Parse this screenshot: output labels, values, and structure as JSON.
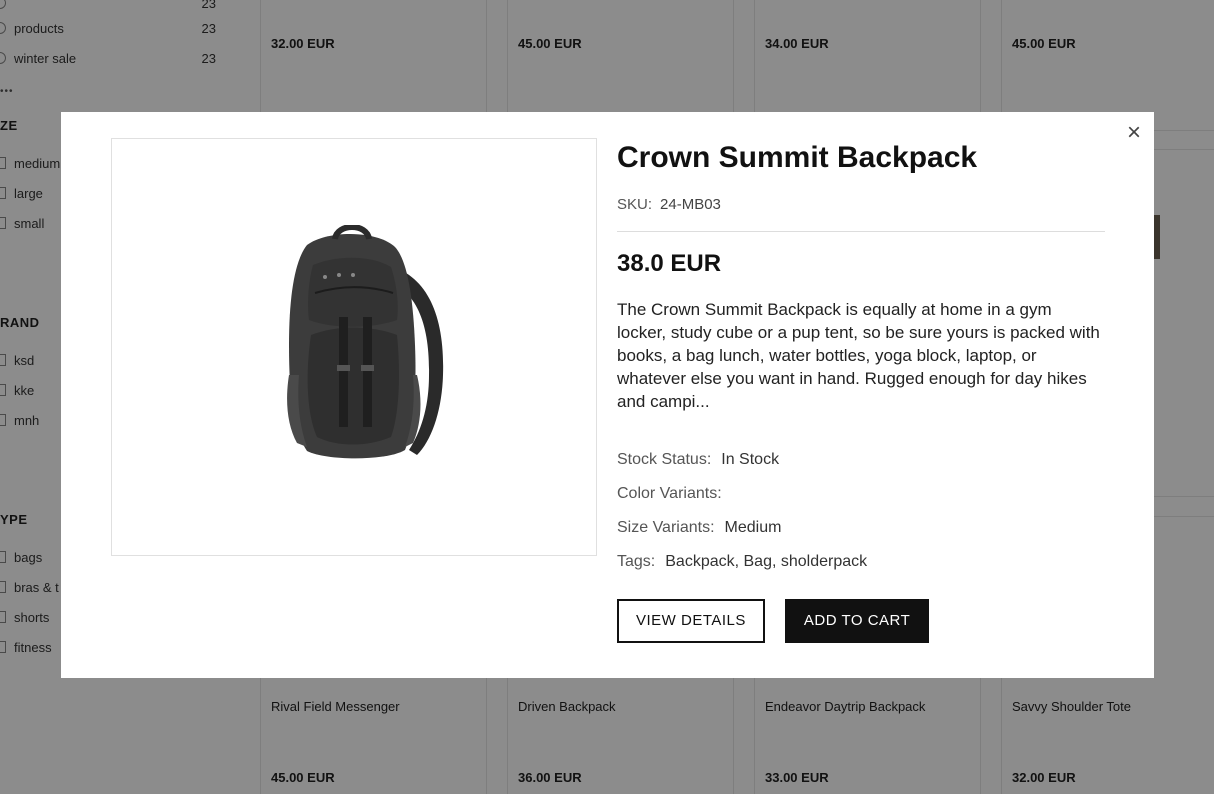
{
  "sidebar": {
    "category_items": [
      {
        "label": "products",
        "count": "23"
      },
      {
        "label": "winter sale",
        "count": "23"
      }
    ],
    "top_cut_count": "23",
    "more": "•••",
    "size": {
      "heading": "ZE",
      "items": [
        "medium",
        "large",
        "small"
      ]
    },
    "brand": {
      "heading": "RAND",
      "items": [
        "ksd",
        "kke",
        "mnh"
      ]
    },
    "type": {
      "heading": "YPE",
      "items": [
        "bags",
        "bras & t",
        "shorts",
        "fitness"
      ]
    }
  },
  "grid": {
    "top_prices": [
      "32.00 EUR",
      "45.00 EUR",
      "34.00 EUR",
      "45.00 EUR"
    ],
    "bottom_products": [
      {
        "name": "Rival Field Messenger",
        "price": "45.00 EUR"
      },
      {
        "name": "Driven Backpack",
        "price": "36.00 EUR"
      },
      {
        "name": "Endeavor Daytrip Backpack",
        "price": "33.00 EUR"
      },
      {
        "name": "Savvy Shoulder Tote",
        "price": "32.00 EUR"
      }
    ]
  },
  "modal": {
    "close": "×",
    "title": "Crown Summit Backpack",
    "sku_label": "SKU:",
    "sku": "24-MB03",
    "price": "38.0 EUR",
    "description": "The Crown Summit Backpack is equally at home in a gym locker, study cube or a pup tent, so be sure yours is packed with books, a bag lunch, water bottles, yoga block, laptop, or whatever else you want in hand. Rugged enough for day hikes and campi...",
    "stock_label": "Stock Status:",
    "stock": "In Stock",
    "color_label": "Color Variants:",
    "color": "",
    "size_label": "Size Variants:",
    "size": "Medium",
    "tags_label": "Tags:",
    "tags": "Backpack, Bag, sholderpack",
    "view_details": "VIEW DETAILS",
    "add_to_cart": "ADD TO CART"
  },
  "colors": {
    "overlay": "rgba(0,0,0,0.45)",
    "button_dark": "#111111"
  },
  "icons": {
    "close": "close-icon",
    "image": "backpack-image"
  }
}
